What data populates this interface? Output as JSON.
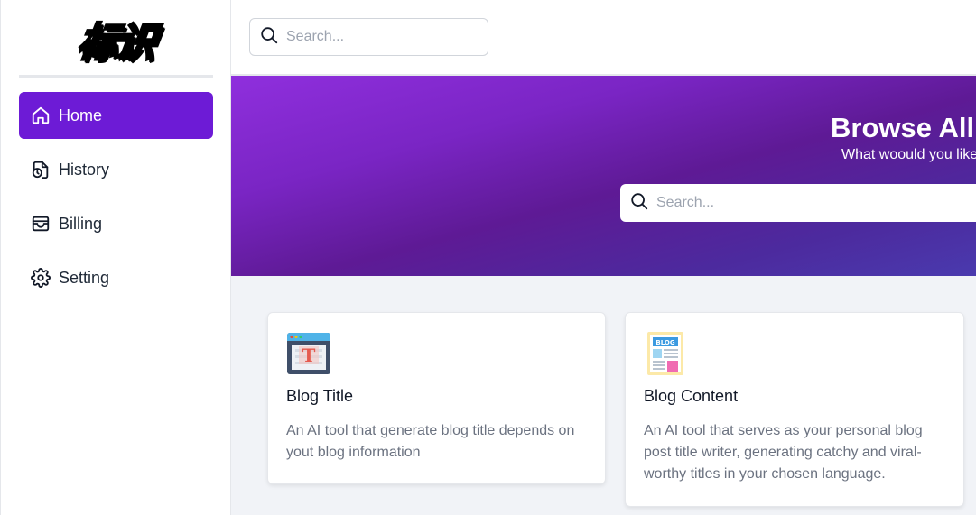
{
  "sidebar": {
    "logo_text": "标识",
    "items": [
      {
        "label": "Home",
        "icon": "home-icon",
        "active": true
      },
      {
        "label": "History",
        "icon": "history-icon",
        "active": false
      },
      {
        "label": "Billing",
        "icon": "billing-icon",
        "active": false
      },
      {
        "label": "Setting",
        "icon": "gear-icon",
        "active": false
      }
    ]
  },
  "header": {
    "search_placeholder": "Search..."
  },
  "hero": {
    "title": "Browse All Templates",
    "subtitle": "What woould you like to create today?",
    "search_placeholder": "Search..."
  },
  "templates": [
    {
      "title": "Blog Title",
      "description": "An AI tool that generate blog title depends on yout blog information",
      "icon": "blog-title-icon"
    },
    {
      "title": "Blog Content",
      "description": "An AI tool that serves as your personal blog post title writer, generating catchy and viral-worthy titles in your chosen language.",
      "icon": "blog-content-icon"
    }
  ],
  "colors": {
    "accent": "#6d1bd6",
    "hero_start": "#8f2fdd",
    "hero_end": "#4a3aae",
    "content_bg": "#f1f3f7"
  }
}
